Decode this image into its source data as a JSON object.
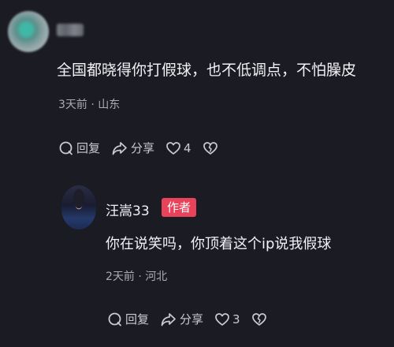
{
  "comment": {
    "text": "全国都晓得你打假球，也不低调点，不怕臊皮",
    "meta": "3天前 · 山东",
    "actions": {
      "reply": "回复",
      "share": "分享",
      "likes": "4"
    }
  },
  "reply": {
    "author": "汪嵩33",
    "badge": "作者",
    "text": "你在说笑吗，你顶着这个ip说我假球",
    "meta": "2天前 · 河北",
    "actions": {
      "reply": "回复",
      "share": "分享",
      "likes": "3"
    }
  },
  "icons": [
    "reply-icon",
    "share-icon",
    "heart-icon",
    "dislike-heart-icon"
  ],
  "colors": {
    "background": "#1b1b24",
    "badge": "#e8435a",
    "meta": "#a9abb4"
  }
}
